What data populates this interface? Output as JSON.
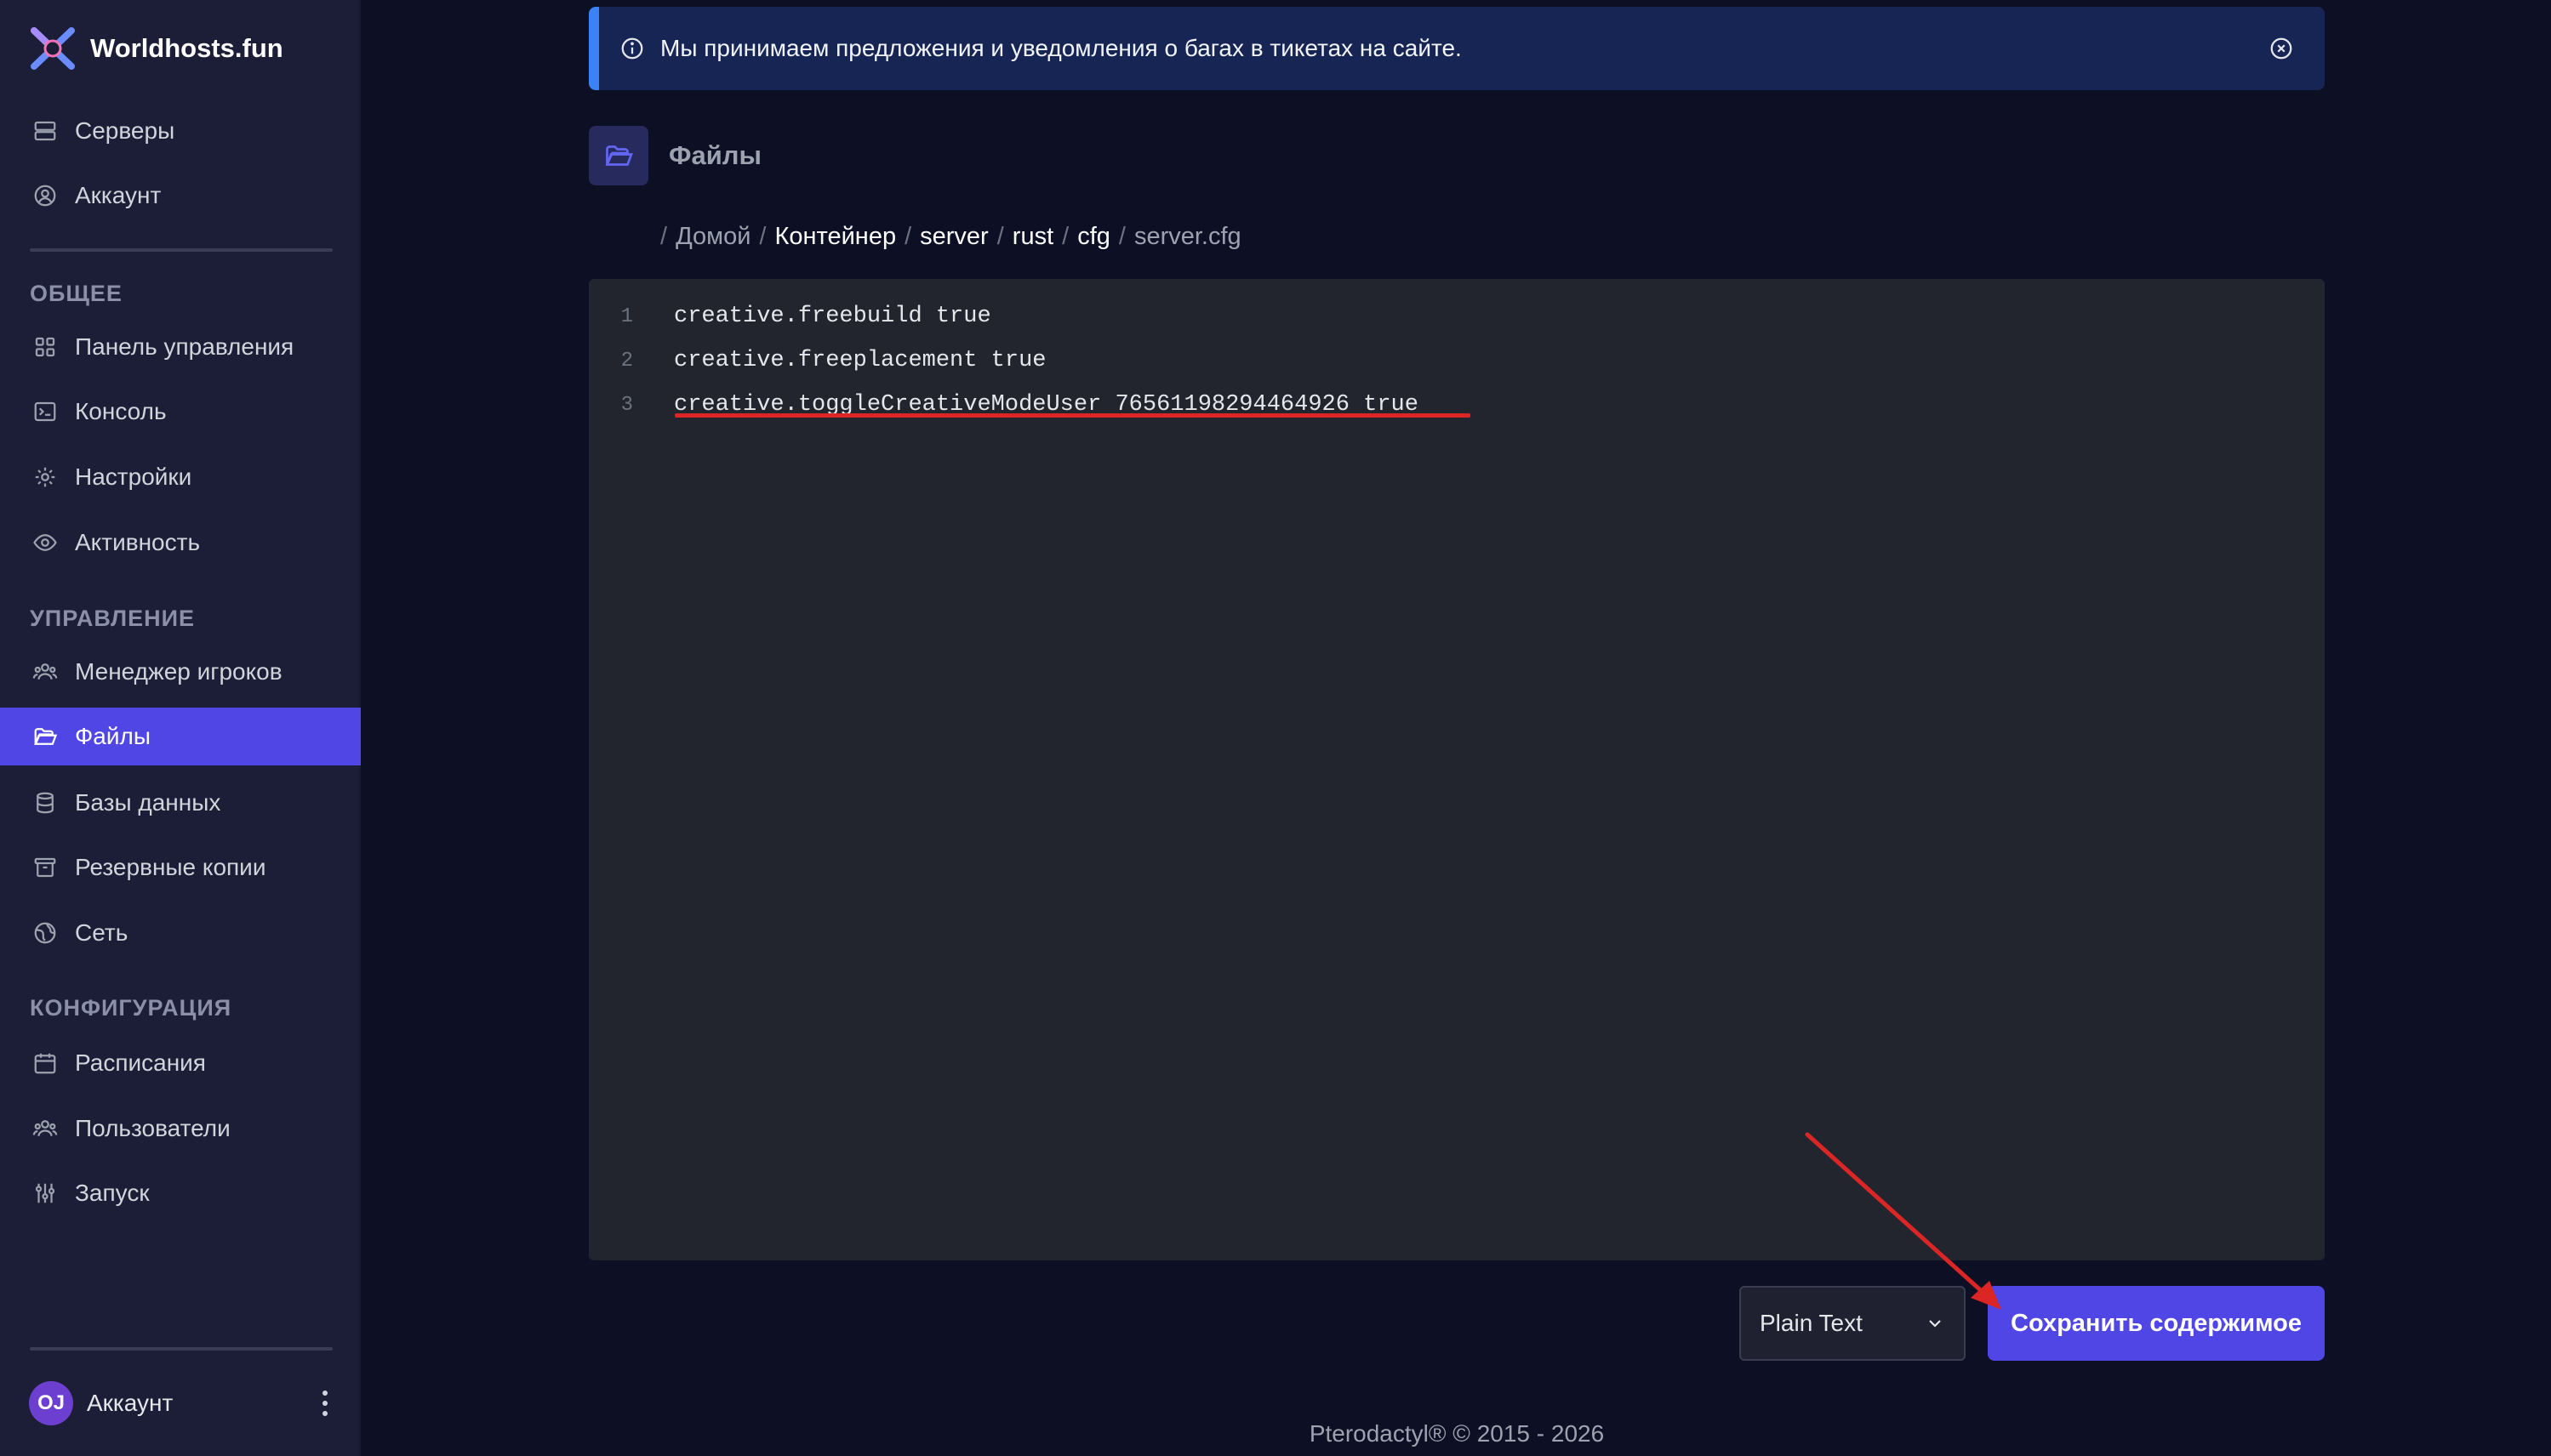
{
  "brand": {
    "name": "Worldhosts.fun",
    "logo": "x-shield-logo"
  },
  "sidebar": {
    "top_items": [
      {
        "label": "Серверы",
        "icon": "server-icon"
      },
      {
        "label": "Аккаунт",
        "icon": "user-circle-icon"
      }
    ],
    "sections": [
      {
        "title": "ОБЩЕЕ",
        "items": [
          {
            "label": "Панель управления",
            "icon": "grid-icon"
          },
          {
            "label": "Консоль",
            "icon": "terminal-icon"
          },
          {
            "label": "Настройки",
            "icon": "gear-icon"
          },
          {
            "label": "Активность",
            "icon": "eye-icon"
          }
        ]
      },
      {
        "title": "УПРАВЛЕНИЕ",
        "items": [
          {
            "label": "Менеджер игроков",
            "icon": "users-icon"
          },
          {
            "label": "Файлы",
            "icon": "folder-open-icon",
            "active": true
          },
          {
            "label": "Базы данных",
            "icon": "database-icon"
          },
          {
            "label": "Резервные копии",
            "icon": "archive-icon"
          },
          {
            "label": "Сеть",
            "icon": "globe-icon"
          }
        ]
      },
      {
        "title": "КОНФИГУРАЦИЯ",
        "items": [
          {
            "label": "Расписания",
            "icon": "calendar-icon"
          },
          {
            "label": "Пользователи",
            "icon": "users-icon"
          },
          {
            "label": "Запуск",
            "icon": "sliders-icon"
          }
        ]
      }
    ],
    "account": {
      "initials": "OJ",
      "label": "Аккаунт"
    }
  },
  "notice": {
    "text": "Мы принимаем предложения и уведомления о багах в тикетах на сайте."
  },
  "page": {
    "title": "Файлы"
  },
  "breadcrumb": {
    "home": "Домой",
    "parts": [
      "Контейнер",
      "server",
      "rust",
      "cfg"
    ],
    "current": "server.cfg"
  },
  "editor": {
    "lines": [
      "creative.freebuild true",
      "creative.freeplacement true",
      "creative.toggleCreativeModeUser 76561198294464926 true"
    ]
  },
  "controls": {
    "language": "Plain Text",
    "save_label": "Сохранить содержимое"
  },
  "footer": {
    "text": "Pterodactyl® © 2015 - 2026"
  },
  "colors": {
    "accent": "#4f46e5",
    "annotation": "#dc2626",
    "notice_border": "#3b82f6"
  }
}
